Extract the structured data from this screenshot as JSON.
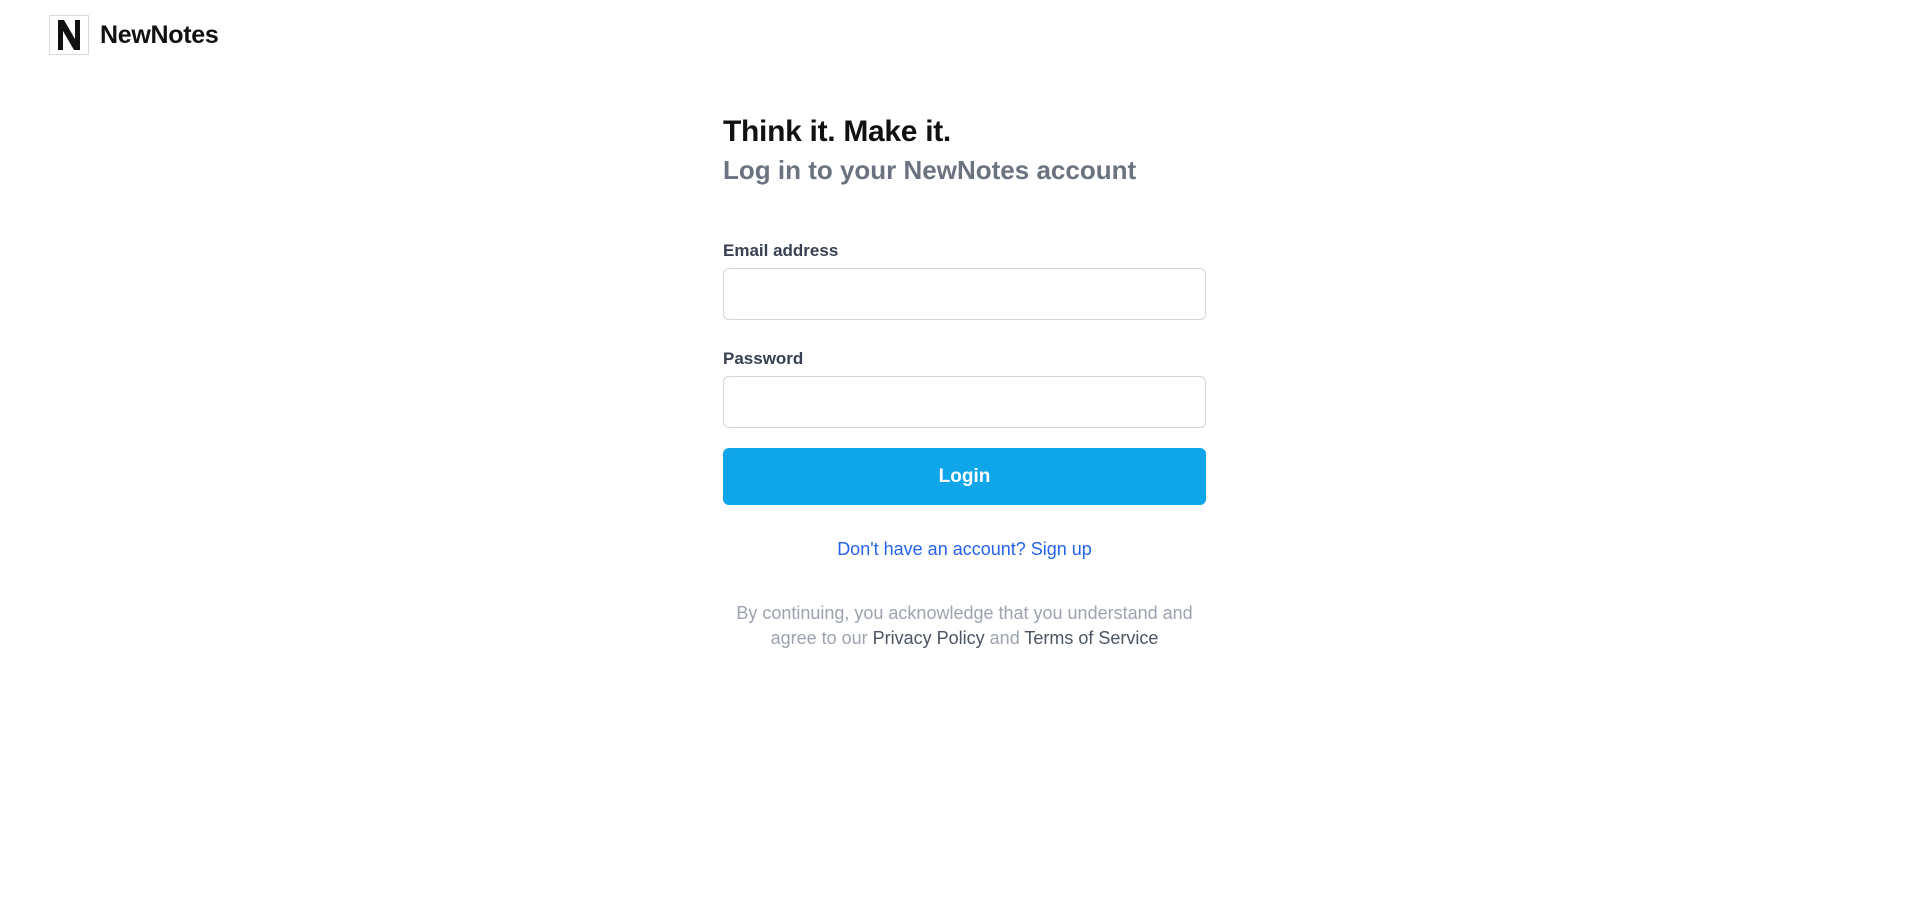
{
  "header": {
    "logo_icon": "newnotes-logo-icon",
    "logo_letter": "N",
    "brand_name": "NewNotes"
  },
  "login": {
    "title": "Think it. Make it.",
    "subtitle": "Log in to your NewNotes account",
    "email_label": "Email address",
    "email_value": "",
    "password_label": "Password",
    "password_value": "",
    "login_button_label": "Login",
    "signup_link": "Don't have an account? Sign up",
    "legal_prefix": "By continuing, you acknowledge that you understand and agree to our ",
    "privacy_policy_link": "Privacy Policy",
    "legal_and": " and ",
    "terms_link": "Terms of Service"
  },
  "colors": {
    "accent": "#0ea5e9",
    "link": "#2563eb",
    "muted_text": "#6b7280",
    "legal_text": "#9ca3af"
  }
}
